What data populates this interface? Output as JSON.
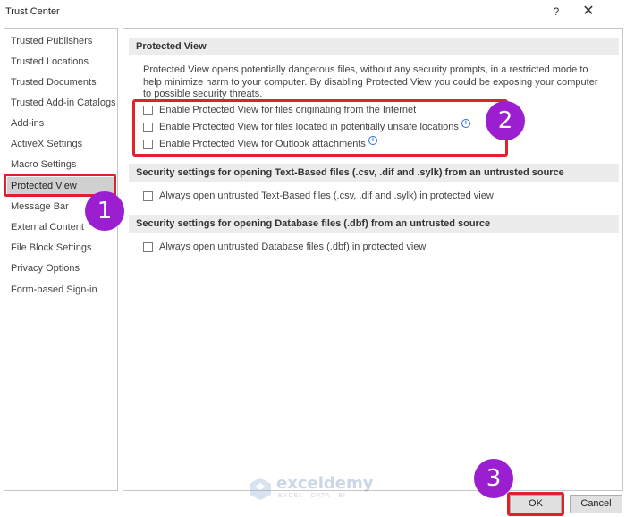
{
  "window": {
    "title": "Trust Center",
    "help_label": "?",
    "close_label": "✕"
  },
  "sidebar": {
    "items": [
      {
        "label": "Trusted Publishers"
      },
      {
        "label": "Trusted Locations"
      },
      {
        "label": "Trusted Documents"
      },
      {
        "label": "Trusted Add-in Catalogs"
      },
      {
        "label": "Add-ins"
      },
      {
        "label": "ActiveX Settings"
      },
      {
        "label": "Macro Settings"
      },
      {
        "label": "Protected View"
      },
      {
        "label": "Message Bar"
      },
      {
        "label": "External Content"
      },
      {
        "label": "File Block Settings"
      },
      {
        "label": "Privacy Options"
      },
      {
        "label": "Form-based Sign-in"
      }
    ],
    "selected": "Protected View"
  },
  "protected_view": {
    "heading": "Protected View",
    "description": "Protected View opens potentially dangerous files, without any security prompts, in a restricted mode to help minimize harm to your computer. By disabling Protected View you could be exposing your computer to possible security threats.",
    "options": [
      {
        "label": "Enable Protected View for files originating from the Internet",
        "checked": false,
        "info": false
      },
      {
        "label": "Enable Protected View for files located in potentially unsafe locations",
        "checked": false,
        "info": true
      },
      {
        "label": "Enable Protected View for Outlook attachments",
        "checked": false,
        "info": true
      }
    ]
  },
  "text_based": {
    "heading": "Security settings for opening Text-Based files (.csv, .dif and .sylk) from an untrusted source",
    "option": {
      "label": "Always open untrusted Text-Based files (.csv, .dif and .sylk) in protected view",
      "checked": false
    }
  },
  "database": {
    "heading": "Security settings for opening Database files (.dbf) from an untrusted source",
    "option": {
      "label": "Always open untrusted Database files (.dbf) in protected view",
      "checked": false
    }
  },
  "buttons": {
    "ok": "OK",
    "cancel": "Cancel"
  },
  "annotations": {
    "step1": "1",
    "step2": "2",
    "step3": "3",
    "color": "#9b1fd1",
    "box_color": "#e0202a"
  },
  "watermark": {
    "name": "exceldemy",
    "tagline": "EXCEL · DATA · BI"
  }
}
